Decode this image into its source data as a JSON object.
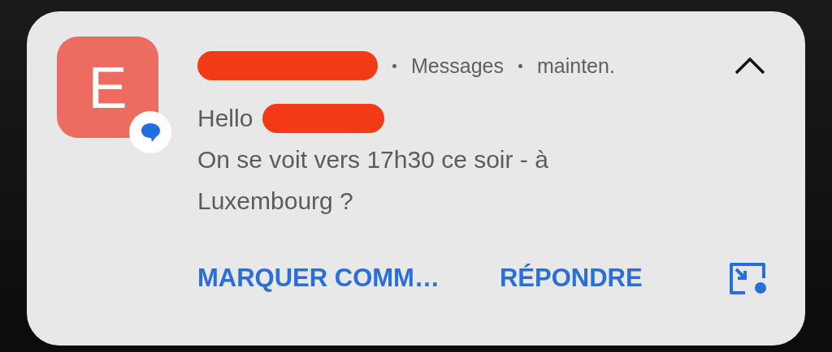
{
  "notification": {
    "avatar_letter": "E",
    "app": "Messages",
    "time": "mainten.",
    "expanded": true,
    "greeting": "Hello",
    "message": "On se voit vers 17h30 ce soir - à Luxembourg ?",
    "actions": [
      {
        "kind": "text",
        "label": "MARQUER COMM…"
      },
      {
        "kind": "text",
        "label": "RÉPONDRE"
      },
      {
        "kind": "icon"
      }
    ]
  }
}
